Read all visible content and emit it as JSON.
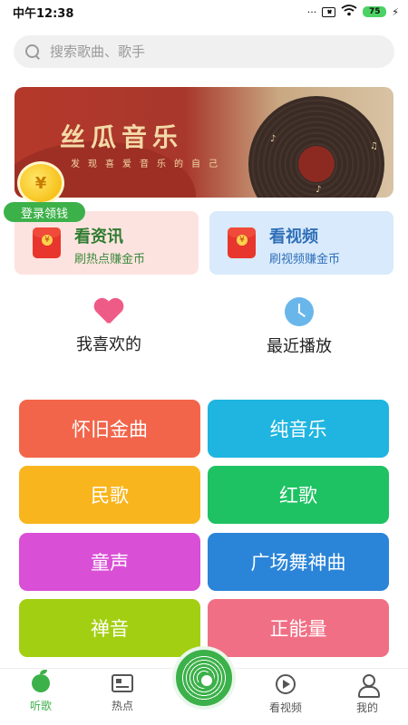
{
  "status_bar": {
    "time": "中午12:38",
    "battery": "75"
  },
  "search": {
    "placeholder": "搜索歌曲、歌手"
  },
  "banner": {
    "title": "丝瓜音乐",
    "subtitle": "发现喜爱音乐的自己"
  },
  "coin": {
    "symbol": "¥"
  },
  "login_badge": "登录领钱",
  "promos": [
    {
      "title": "看资讯",
      "subtitle": "刷热点赚金币"
    },
    {
      "title": "看视频",
      "subtitle": "刷视频赚金币"
    }
  ],
  "shortcuts": {
    "favorites": "我喜欢的",
    "recent": "最近播放"
  },
  "categories": [
    {
      "label": "怀旧金曲",
      "color": "#f2654a"
    },
    {
      "label": "纯音乐",
      "color": "#1fb5e0"
    },
    {
      "label": "民歌",
      "color": "#f8b51d"
    },
    {
      "label": "红歌",
      "color": "#1ec263"
    },
    {
      "label": "童声",
      "color": "#d94fd6"
    },
    {
      "label": "广场舞神曲",
      "color": "#2a84d8"
    },
    {
      "label": "禅音",
      "color": "#a3cf12"
    },
    {
      "label": "正能量",
      "color": "#f06f84"
    }
  ],
  "bottom_nav": {
    "listen": "听歌",
    "hot": "热点",
    "video": "看视频",
    "mine": "我的"
  },
  "colors": {
    "accent": "#3cb14a"
  }
}
